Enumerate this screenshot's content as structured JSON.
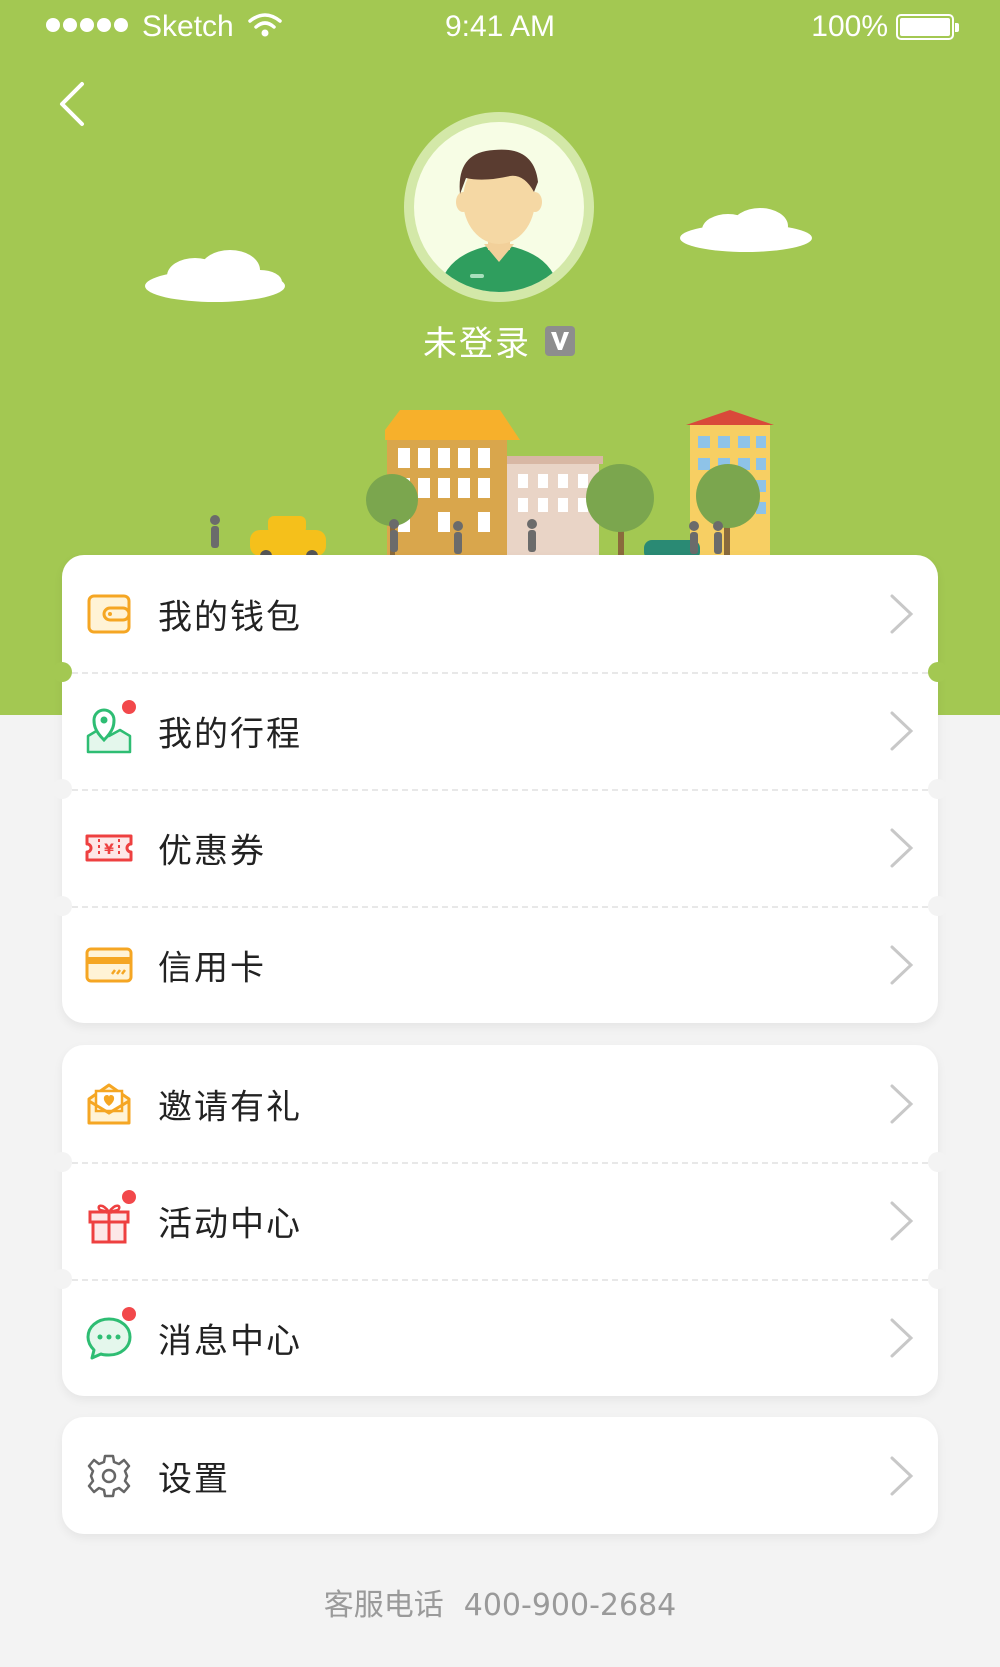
{
  "status_bar": {
    "carrier": "Sketch",
    "time": "9:41 AM",
    "battery": "100%"
  },
  "profile": {
    "username": "未登录"
  },
  "menu_groups": [
    {
      "items": [
        {
          "label": "我的钱包",
          "icon": "wallet-icon",
          "dot": false
        },
        {
          "label": "我的行程",
          "icon": "map-pin-icon",
          "dot": true
        },
        {
          "label": "优惠券",
          "icon": "coupon-icon",
          "dot": false
        },
        {
          "label": "信用卡",
          "icon": "credit-card-icon",
          "dot": false
        }
      ]
    },
    {
      "items": [
        {
          "label": "邀请有礼",
          "icon": "invite-envelope-icon",
          "dot": false
        },
        {
          "label": "活动中心",
          "icon": "gift-icon",
          "dot": true
        },
        {
          "label": "消息中心",
          "icon": "message-icon",
          "dot": true
        }
      ]
    },
    {
      "items": [
        {
          "label": "设置",
          "icon": "gear-icon",
          "dot": false
        }
      ]
    }
  ],
  "footer": {
    "label": "客服电话",
    "phone": "400-900-2684"
  },
  "colors": {
    "hero_green": "#a3c852",
    "notification_dot": "#f2484b"
  }
}
